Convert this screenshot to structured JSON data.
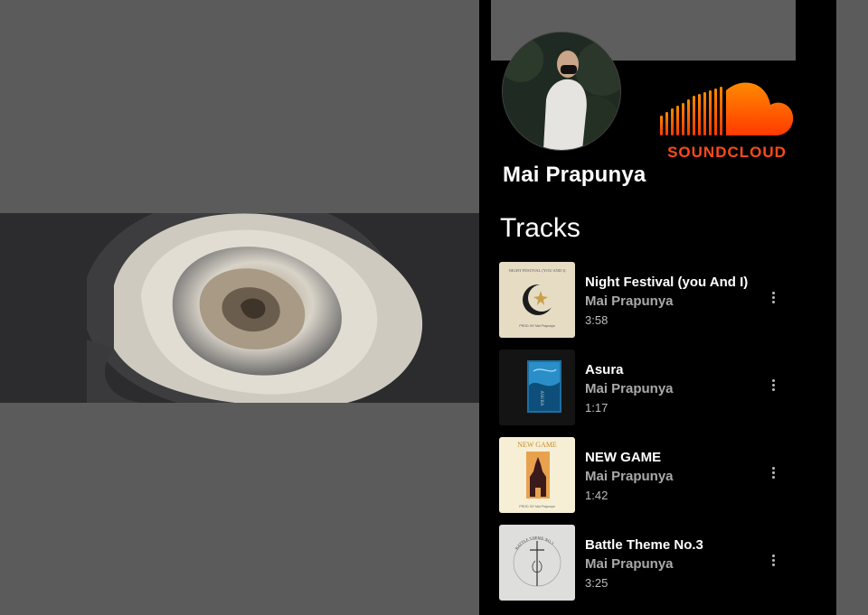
{
  "profile": {
    "artist_name": "Mai Prapunya",
    "logo_text": "SOUNDCLOUD",
    "brand_color": "#ff5500"
  },
  "tracks_heading": "Tracks",
  "tracks": [
    {
      "title": "Night Festival (you And I)",
      "artist": "Mai Prapunya",
      "duration": "3:58",
      "art_text": "NIGHT FESTIVAL (YOU AND I)",
      "art_footer": "PROD. BY Mai Prapunya"
    },
    {
      "title": "Asura",
      "artist": "Mai Prapunya",
      "duration": "1:17",
      "art_text": "ASURA"
    },
    {
      "title": "NEW GAME",
      "artist": "Mai Prapunya",
      "duration": "1:42",
      "art_text": "NEW GAME",
      "art_footer": "PROD. BY Mai Prapunya"
    },
    {
      "title": "Battle Theme No.3",
      "artist": "Mai Prapunya",
      "duration": "3:25",
      "art_text": "BATTLE THEME NO.3"
    }
  ],
  "icons": {
    "more": "more-vertical-icon"
  }
}
